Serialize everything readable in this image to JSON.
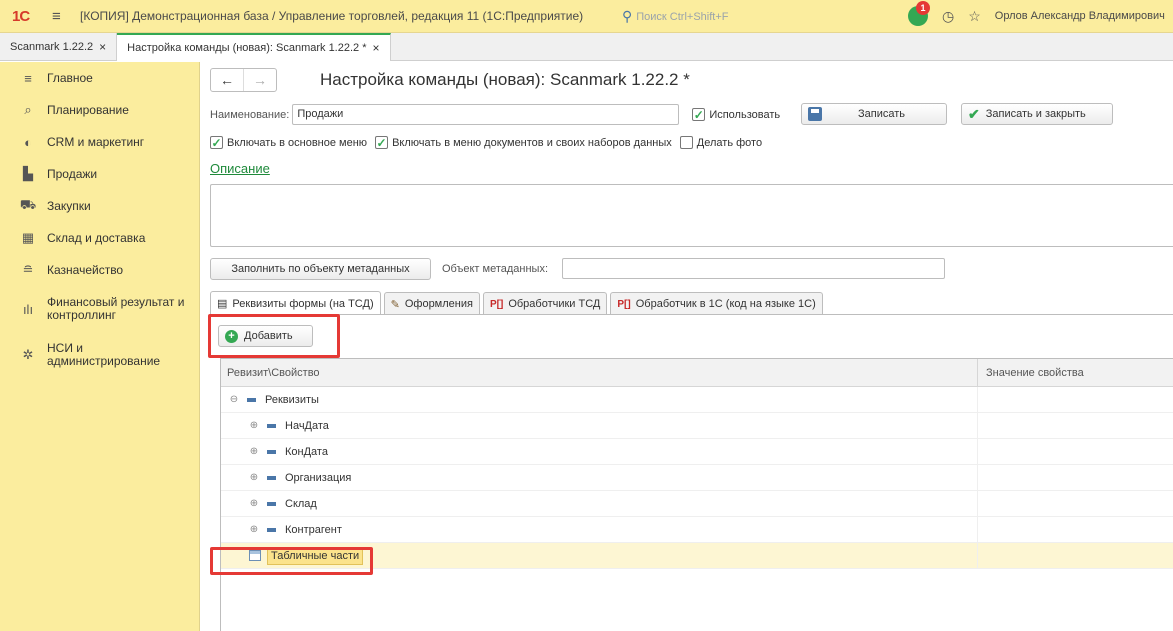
{
  "titlebar": {
    "logo": "1С",
    "title": "[КОПИЯ] Демонстрационная база / Управление торговлей, редакция 11  (1С:Предприятие)",
    "search_placeholder": "Поиск Ctrl+Shift+F",
    "notifications_count": "1",
    "user": "Орлов Александр Владимирович"
  },
  "window_tabs": [
    {
      "label": "Scanmark 1.22.2",
      "close": "×"
    },
    {
      "label": "Настройка команды (новая): Scanmark 1.22.2 *",
      "close": "×"
    }
  ],
  "sidebar": {
    "items": [
      {
        "label": "Главное",
        "icon": "menu-icon"
      },
      {
        "label": "Планирование",
        "icon": "planning-icon"
      },
      {
        "label": "CRM и маркетинг",
        "icon": "crm-icon"
      },
      {
        "label": "Продажи",
        "icon": "bag-icon"
      },
      {
        "label": "Закупки",
        "icon": "cart-icon"
      },
      {
        "label": "Склад и доставка",
        "icon": "warehouse-icon"
      },
      {
        "label": "Казначейство",
        "icon": "coins-icon"
      },
      {
        "label": "Финансовый результат и контроллинг",
        "icon": "chart-icon"
      },
      {
        "label": "НСИ и администрирование",
        "icon": "gear-icon"
      }
    ]
  },
  "form": {
    "title": "Настройка команды (новая): Scanmark 1.22.2 *",
    "name_label": "Наименование:",
    "name_value": "Продажи",
    "use_label": "Использовать",
    "save_label": "Записать",
    "save_close_label": "Записать и закрыть",
    "check_main_menu": "Включать в основное меню",
    "check_doc_menu": "Включать в меню документов и своих наборов данных",
    "check_photo": "Делать фото",
    "description_link": "Описание",
    "fill_button": "Заполнить по объекту метаданных",
    "meta_label": "Объект метаданных:",
    "meta_value": ""
  },
  "form_tabs": [
    {
      "label": "Реквизиты формы (на ТСД)"
    },
    {
      "label": "Оформления"
    },
    {
      "label": "Обработчики ТСД"
    },
    {
      "label": "Обработчик в 1С  (код на языке 1С)"
    }
  ],
  "add_button": "Добавить",
  "grid": {
    "columns": [
      "Ревизит\\Свойство",
      "Значение свойства"
    ],
    "rows": [
      {
        "expander": "⊖",
        "label": "Реквизиты"
      },
      {
        "expander": "⊕",
        "label": "НачДата"
      },
      {
        "expander": "⊕",
        "label": "КонДата"
      },
      {
        "expander": "⊕",
        "label": "Организация"
      },
      {
        "expander": "⊕",
        "label": "Склад"
      },
      {
        "expander": "⊕",
        "label": "Контрагент"
      },
      {
        "label": "Табличные части"
      }
    ]
  },
  "colors": {
    "accent": "#34a853",
    "panel": "#fbed9e",
    "highlight": "#e53935"
  }
}
